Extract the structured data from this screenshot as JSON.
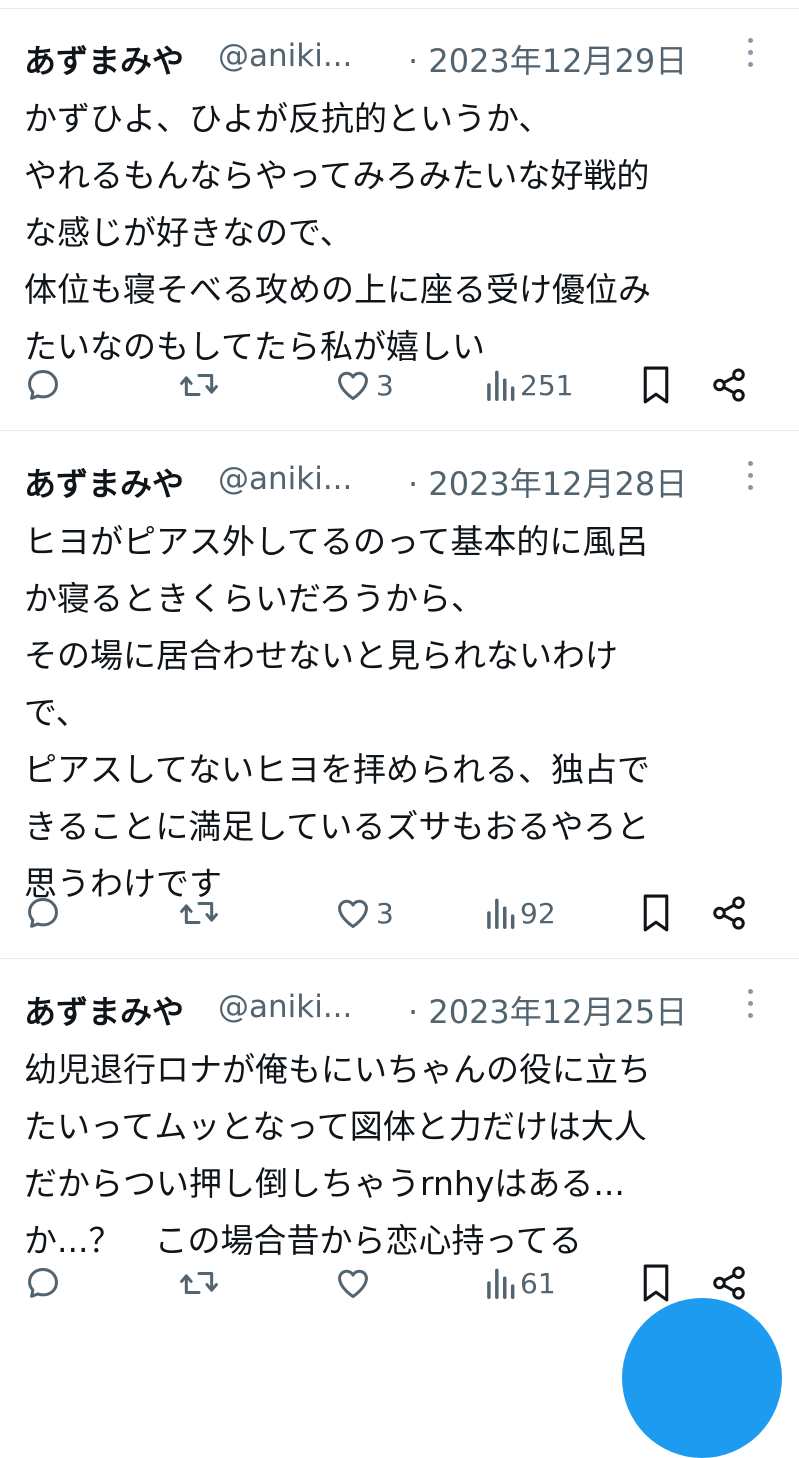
{
  "tweets": [
    {
      "author": "あずまみや",
      "handle": "@aniki...",
      "date": "· 2023年12月29日",
      "lines": [
        "かずひよ、ひよが反抗的というか、",
        "やれるもんならやってみろみたいな好戦的",
        "な感じが好きなので、",
        "体位も寝そべる攻めの上に座る受け優位み",
        "たいなのもしてたら私が嬉しい"
      ],
      "likes": "3",
      "views": "251"
    },
    {
      "author": "あずまみや",
      "handle": "@aniki...",
      "date": "· 2023年12月28日",
      "lines": [
        "ヒヨがピアス外してるのって基本的に風呂",
        "か寝るときくらいだろうから、",
        "その場に居合わせないと見られないわけ",
        "で、",
        "ピアスしてないヒヨを拝められる、独占で",
        "きることに満足しているズサもおるやろと",
        "思うわけです"
      ],
      "likes": "3",
      "views": "92"
    },
    {
      "author": "あずまみや",
      "handle": "@aniki...",
      "date": "· 2023年12月25日",
      "lines": [
        "幼児退行ロナが俺もにいちゃんの役に立ち",
        "たいってムッとなって図体と力だけは大人",
        "だからつい押し倒しちゃうrnhyはある...",
        "か...？　この場合昔から恋心持ってる"
      ],
      "likes": "",
      "views": "61"
    }
  ],
  "icons": [
    "reply-icon",
    "retweet-icon",
    "like-icon",
    "views-icon",
    "bookmark-icon",
    "share-icon",
    "more-icon"
  ],
  "colors": {
    "text": "#0f1419",
    "secondary": "#536471",
    "divider": "#e6e9ec",
    "accent": "#1d9bf0"
  }
}
